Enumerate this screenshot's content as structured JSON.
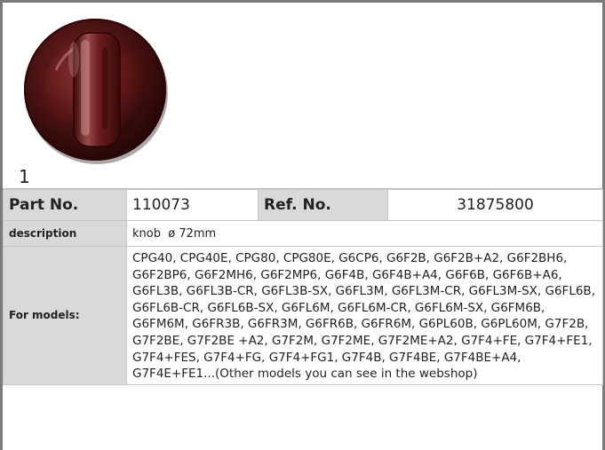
{
  "product": {
    "image_alt": "knob",
    "image_number": "1",
    "colors": {
      "knob_dark": "#3a0c0c",
      "knob_mid": "#6b1a1a",
      "knob_highlight": "#c98a8a",
      "label_bg": "#d9d9d9",
      "frame": "#7a7a7a"
    }
  },
  "table": {
    "part_no_label": "Part No.",
    "part_no_value": "110073",
    "ref_no_label": "Ref. No.",
    "ref_no_value": "31875800",
    "description_label": "description",
    "description_value": "knob  ø 72mm",
    "models_label": "For models:",
    "models_value": "CPG40, CPG40E, CPG80, CPG80E, G6CP6, G6F2B, G6F2B+A2, G6F2BH6, G6F2BP6, G6F2MH6, G6F2MP6, G6F4B, G6F4B+A4, G6F6B, G6F6B+A6, G6FL3B, G6FL3B-CR, G6FL3B-SX, G6FL3M, G6FL3M-CR, G6FL3M-SX, G6FL6B, G6FL6B-CR, G6FL6B-SX, G6FL6M, G6FL6M-CR, G6FL6M-SX, G6FM6B, G6FM6M, G6FR3B, G6FR3M, G6FR6B, G6FR6M, G6PL60B, G6PL60M, G7F2B, G7F2BE, G7F2BE +A2, G7F2M, G7F2ME, G7F2ME+A2, G7F4+FE, G7F4+FE1, G7F4+FES, G7F4+FG, G7F4+FG1, G7F4B, G7F4BE, G7F4BE+A4, G7F4E+FE1...(Other models you can see in the webshop)"
  }
}
